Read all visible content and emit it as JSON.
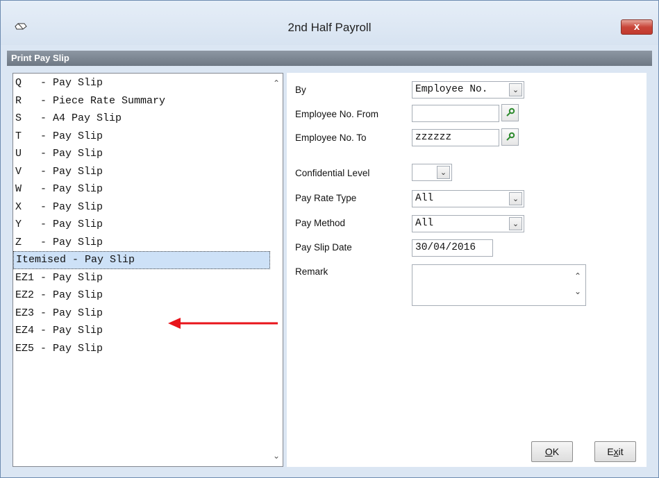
{
  "window": {
    "title": "2nd Half Payroll",
    "close_label": "x"
  },
  "section": {
    "title": "Print Pay Slip"
  },
  "report_list": [
    {
      "code": "Q",
      "name": "Q   - Pay Slip"
    },
    {
      "code": "R",
      "name": "R   - Piece Rate Summary"
    },
    {
      "code": "S",
      "name": "S   - A4 Pay Slip"
    },
    {
      "code": "T",
      "name": "T   - Pay Slip"
    },
    {
      "code": "U",
      "name": "U   - Pay Slip"
    },
    {
      "code": "V",
      "name": "V   - Pay Slip"
    },
    {
      "code": "W",
      "name": "W   - Pay Slip"
    },
    {
      "code": "X",
      "name": "X   - Pay Slip"
    },
    {
      "code": "Y",
      "name": "Y   - Pay Slip"
    },
    {
      "code": "Z",
      "name": "Z   - Pay Slip"
    },
    {
      "code": "Itemised",
      "name": "Itemised - Pay Slip",
      "selected": true
    },
    {
      "code": "EZ1",
      "name": "EZ1 - Pay Slip"
    },
    {
      "code": "EZ2",
      "name": "EZ2 - Pay Slip"
    },
    {
      "code": "EZ3",
      "name": "EZ3 - Pay Slip"
    },
    {
      "code": "EZ4",
      "name": "EZ4 - Pay Slip"
    },
    {
      "code": "EZ5",
      "name": "EZ5 - Pay Slip"
    }
  ],
  "form": {
    "by": {
      "label": "By",
      "value": "Employee No."
    },
    "employee_from": {
      "label": "Employee No. From",
      "value": ""
    },
    "employee_to": {
      "label": "Employee No. To",
      "value": "zzzzzz"
    },
    "confidential_level": {
      "label": "Confidential Level",
      "value": ""
    },
    "pay_rate_type": {
      "label": "Pay Rate Type",
      "value": "All"
    },
    "pay_method": {
      "label": "Pay Method",
      "value": "All"
    },
    "pay_slip_date": {
      "label": "Pay Slip Date",
      "value": "30/04/2016"
    },
    "remark": {
      "label": "Remark",
      "value": ""
    }
  },
  "buttons": {
    "ok": {
      "mnemonic": "O",
      "rest": "K"
    },
    "exit": {
      "first": "E",
      "mnemonic": "x",
      "rest": "it"
    }
  },
  "colors": {
    "annotation_arrow": "#e8141b",
    "selection": "#cde1f7",
    "close_button": "#c9463a"
  }
}
